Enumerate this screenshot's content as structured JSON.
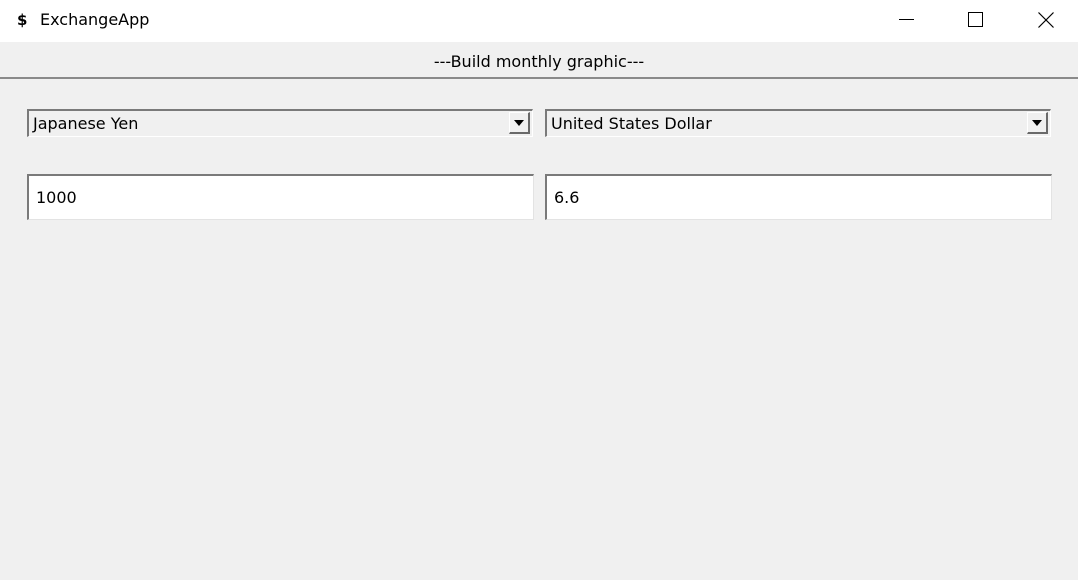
{
  "window": {
    "icon_glyph": "$",
    "icon_name": "dollar-icon",
    "title": "ExchangeApp",
    "controls": [
      "minimize",
      "maximize",
      "close"
    ]
  },
  "toolbar": {
    "build_graphic_label": "---Build monthly graphic---"
  },
  "converter": {
    "from_currency": "Japanese Yen",
    "to_currency": "United States Dollar",
    "from_amount": "1000",
    "to_amount": "6.6"
  },
  "colors": {
    "background": "#f0f0f0",
    "titlebar": "#ffffff",
    "text": "#000000"
  }
}
